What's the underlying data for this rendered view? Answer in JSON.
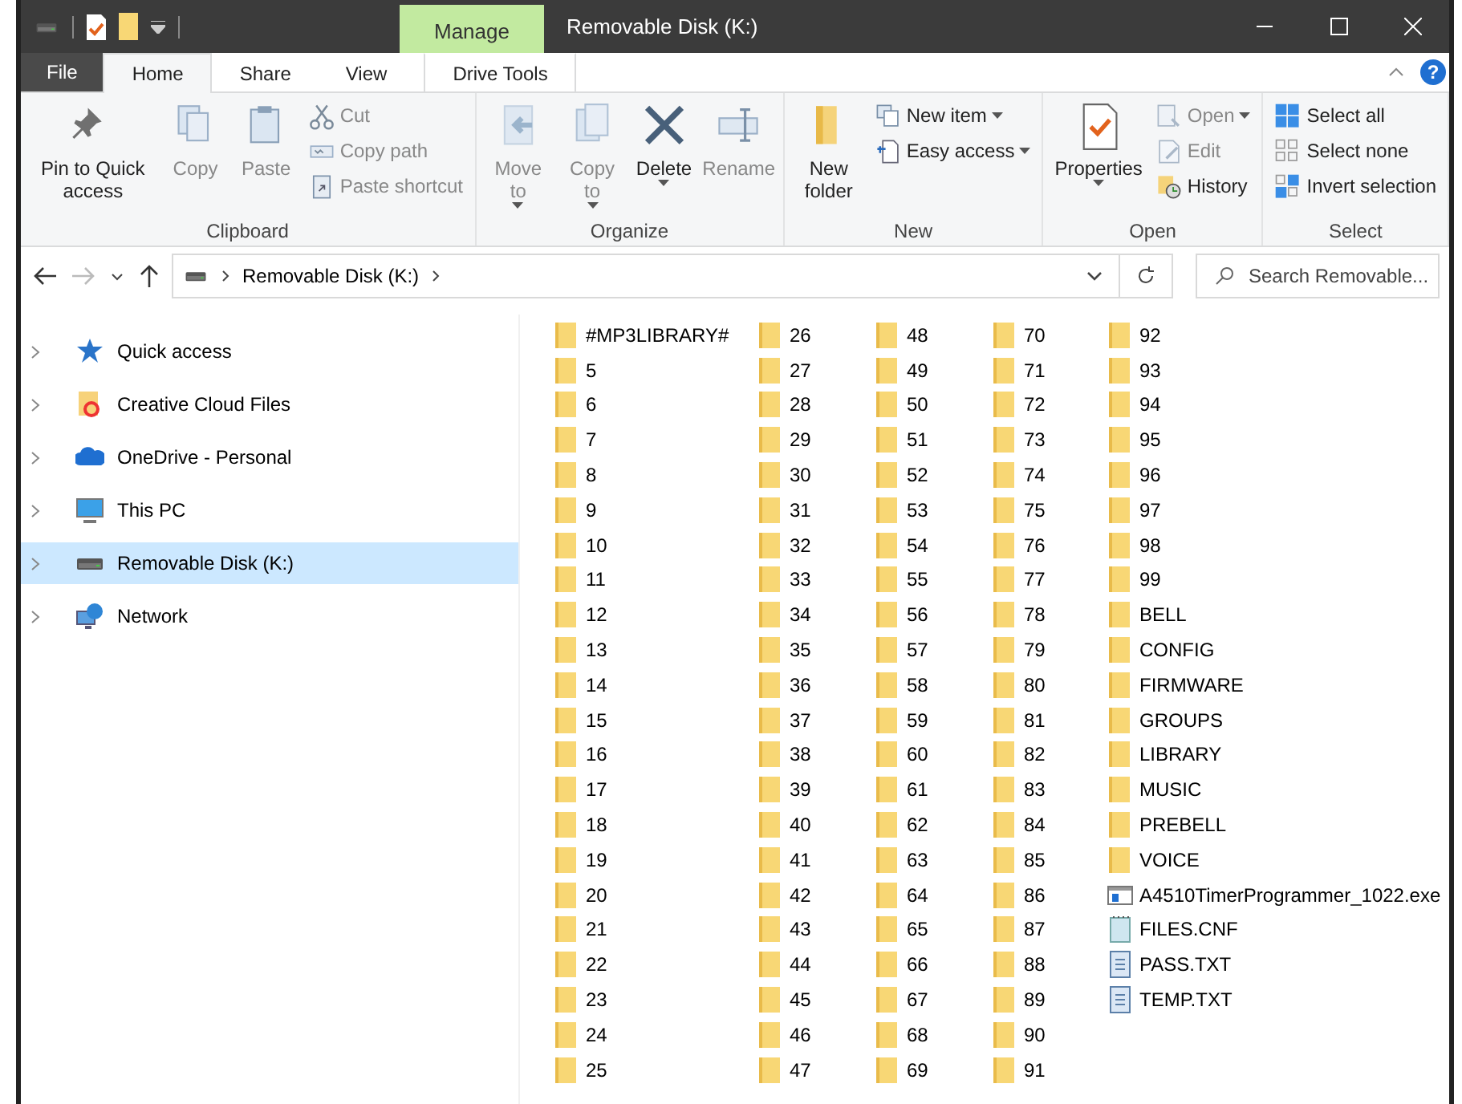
{
  "window": {
    "context_tab": "Manage",
    "title": "Removable Disk (K:)"
  },
  "ribbon_tabs": [
    {
      "label": "File",
      "kind": "file",
      "selected": false
    },
    {
      "label": "Home",
      "kind": "tab",
      "selected": true
    },
    {
      "label": "Share",
      "kind": "tab",
      "selected": false
    },
    {
      "label": "View",
      "kind": "tab",
      "selected": false
    },
    {
      "label": "Drive Tools",
      "kind": "context",
      "selected": false
    }
  ],
  "help": "?",
  "ribbon_groups": [
    {
      "name": "Clipboard",
      "items": [
        {
          "label": "Pin to Quick access",
          "kind": "large",
          "disabled": false,
          "dropdown": false
        },
        {
          "label": "Copy",
          "kind": "large",
          "disabled": true,
          "dropdown": false
        },
        {
          "label": "Paste",
          "kind": "large",
          "disabled": true,
          "dropdown": false
        },
        {
          "kind": "stack",
          "items": [
            {
              "label": "Cut",
              "disabled": true,
              "dropdown": false
            },
            {
              "label": "Copy path",
              "disabled": true,
              "dropdown": false
            },
            {
              "label": "Paste shortcut",
              "disabled": true,
              "dropdown": false
            }
          ]
        }
      ]
    },
    {
      "name": "Organize",
      "items": [
        {
          "label": "Move to",
          "kind": "large",
          "disabled": true,
          "dropdown": true
        },
        {
          "label": "Copy to",
          "kind": "large",
          "disabled": true,
          "dropdown": true
        },
        {
          "label": "Delete",
          "kind": "large",
          "disabled": false,
          "dropdown": true
        },
        {
          "label": "Rename",
          "kind": "large",
          "disabled": true,
          "dropdown": false
        }
      ]
    },
    {
      "name": "New",
      "items": [
        {
          "label": "New folder",
          "kind": "large",
          "disabled": false,
          "dropdown": false
        },
        {
          "kind": "stack",
          "items": [
            {
              "label": "New item",
              "disabled": false,
              "dropdown": true
            },
            {
              "label": "Easy access",
              "disabled": false,
              "dropdown": true
            }
          ]
        }
      ]
    },
    {
      "name": "Open",
      "items": [
        {
          "label": "Properties",
          "kind": "large",
          "disabled": false,
          "dropdown": true
        },
        {
          "kind": "stack",
          "items": [
            {
              "label": "Open",
              "disabled": true,
              "dropdown": true
            },
            {
              "label": "Edit",
              "disabled": true,
              "dropdown": false
            },
            {
              "label": "History",
              "disabled": false,
              "dropdown": false
            }
          ]
        }
      ]
    },
    {
      "name": "Select",
      "items": [
        {
          "kind": "stack",
          "items": [
            {
              "label": "Select all",
              "disabled": false,
              "dropdown": false
            },
            {
              "label": "Select none",
              "disabled": false,
              "dropdown": false
            },
            {
              "label": "Invert selection",
              "disabled": false,
              "dropdown": false
            }
          ]
        }
      ]
    }
  ],
  "address_bar": {
    "path": [
      "Removable Disk (K:)"
    ],
    "back_disabled": false,
    "forward_disabled": true
  },
  "search": {
    "placeholder": "Search Removable..."
  },
  "sidebar": {
    "items": [
      {
        "label": "Quick access",
        "kind": "star",
        "selected": false
      },
      {
        "label": "Creative Cloud Files",
        "kind": "cc",
        "selected": false
      },
      {
        "label": "OneDrive - Personal",
        "kind": "cloud",
        "selected": false
      },
      {
        "label": "This PC",
        "kind": "pc",
        "selected": false
      },
      {
        "label": "Removable Disk (K:)",
        "kind": "drive",
        "selected": true
      },
      {
        "label": "Network",
        "kind": "network",
        "selected": false
      }
    ]
  },
  "files": [
    {
      "name": "#MP3LIBRARY#",
      "kind": "folder"
    },
    {
      "name": "5",
      "kind": "folder"
    },
    {
      "name": "6",
      "kind": "folder"
    },
    {
      "name": "7",
      "kind": "folder"
    },
    {
      "name": "8",
      "kind": "folder"
    },
    {
      "name": "9",
      "kind": "folder"
    },
    {
      "name": "10",
      "kind": "folder"
    },
    {
      "name": "11",
      "kind": "folder"
    },
    {
      "name": "12",
      "kind": "folder"
    },
    {
      "name": "13",
      "kind": "folder"
    },
    {
      "name": "14",
      "kind": "folder"
    },
    {
      "name": "15",
      "kind": "folder"
    },
    {
      "name": "16",
      "kind": "folder"
    },
    {
      "name": "17",
      "kind": "folder"
    },
    {
      "name": "18",
      "kind": "folder"
    },
    {
      "name": "19",
      "kind": "folder"
    },
    {
      "name": "20",
      "kind": "folder"
    },
    {
      "name": "21",
      "kind": "folder"
    },
    {
      "name": "22",
      "kind": "folder"
    },
    {
      "name": "23",
      "kind": "folder"
    },
    {
      "name": "24",
      "kind": "folder"
    },
    {
      "name": "25",
      "kind": "folder"
    },
    {
      "name": "26",
      "kind": "folder"
    },
    {
      "name": "27",
      "kind": "folder"
    },
    {
      "name": "28",
      "kind": "folder"
    },
    {
      "name": "29",
      "kind": "folder"
    },
    {
      "name": "30",
      "kind": "folder"
    },
    {
      "name": "31",
      "kind": "folder"
    },
    {
      "name": "32",
      "kind": "folder"
    },
    {
      "name": "33",
      "kind": "folder"
    },
    {
      "name": "34",
      "kind": "folder"
    },
    {
      "name": "35",
      "kind": "folder"
    },
    {
      "name": "36",
      "kind": "folder"
    },
    {
      "name": "37",
      "kind": "folder"
    },
    {
      "name": "38",
      "kind": "folder"
    },
    {
      "name": "39",
      "kind": "folder"
    },
    {
      "name": "40",
      "kind": "folder"
    },
    {
      "name": "41",
      "kind": "folder"
    },
    {
      "name": "42",
      "kind": "folder"
    },
    {
      "name": "43",
      "kind": "folder"
    },
    {
      "name": "44",
      "kind": "folder"
    },
    {
      "name": "45",
      "kind": "folder"
    },
    {
      "name": "46",
      "kind": "folder"
    },
    {
      "name": "47",
      "kind": "folder"
    },
    {
      "name": "48",
      "kind": "folder"
    },
    {
      "name": "49",
      "kind": "folder"
    },
    {
      "name": "50",
      "kind": "folder"
    },
    {
      "name": "51",
      "kind": "folder"
    },
    {
      "name": "52",
      "kind": "folder"
    },
    {
      "name": "53",
      "kind": "folder"
    },
    {
      "name": "54",
      "kind": "folder"
    },
    {
      "name": "55",
      "kind": "folder"
    },
    {
      "name": "56",
      "kind": "folder"
    },
    {
      "name": "57",
      "kind": "folder"
    },
    {
      "name": "58",
      "kind": "folder"
    },
    {
      "name": "59",
      "kind": "folder"
    },
    {
      "name": "60",
      "kind": "folder"
    },
    {
      "name": "61",
      "kind": "folder"
    },
    {
      "name": "62",
      "kind": "folder"
    },
    {
      "name": "63",
      "kind": "folder"
    },
    {
      "name": "64",
      "kind": "folder"
    },
    {
      "name": "65",
      "kind": "folder"
    },
    {
      "name": "66",
      "kind": "folder"
    },
    {
      "name": "67",
      "kind": "folder"
    },
    {
      "name": "68",
      "kind": "folder"
    },
    {
      "name": "69",
      "kind": "folder"
    },
    {
      "name": "70",
      "kind": "folder"
    },
    {
      "name": "71",
      "kind": "folder"
    },
    {
      "name": "72",
      "kind": "folder"
    },
    {
      "name": "73",
      "kind": "folder"
    },
    {
      "name": "74",
      "kind": "folder"
    },
    {
      "name": "75",
      "kind": "folder"
    },
    {
      "name": "76",
      "kind": "folder"
    },
    {
      "name": "77",
      "kind": "folder"
    },
    {
      "name": "78",
      "kind": "folder"
    },
    {
      "name": "79",
      "kind": "folder"
    },
    {
      "name": "80",
      "kind": "folder"
    },
    {
      "name": "81",
      "kind": "folder"
    },
    {
      "name": "82",
      "kind": "folder"
    },
    {
      "name": "83",
      "kind": "folder"
    },
    {
      "name": "84",
      "kind": "folder"
    },
    {
      "name": "85",
      "kind": "folder"
    },
    {
      "name": "86",
      "kind": "folder"
    },
    {
      "name": "87",
      "kind": "folder"
    },
    {
      "name": "88",
      "kind": "folder"
    },
    {
      "name": "89",
      "kind": "folder"
    },
    {
      "name": "90",
      "kind": "folder"
    },
    {
      "name": "91",
      "kind": "folder"
    },
    {
      "name": "92",
      "kind": "folder"
    },
    {
      "name": "93",
      "kind": "folder"
    },
    {
      "name": "94",
      "kind": "folder"
    },
    {
      "name": "95",
      "kind": "folder"
    },
    {
      "name": "96",
      "kind": "folder"
    },
    {
      "name": "97",
      "kind": "folder"
    },
    {
      "name": "98",
      "kind": "folder"
    },
    {
      "name": "99",
      "kind": "folder"
    },
    {
      "name": "BELL",
      "kind": "folder"
    },
    {
      "name": "CONFIG",
      "kind": "folder"
    },
    {
      "name": "FIRMWARE",
      "kind": "folder"
    },
    {
      "name": "GROUPS",
      "kind": "folder"
    },
    {
      "name": "LIBRARY",
      "kind": "folder"
    },
    {
      "name": "MUSIC",
      "kind": "folder"
    },
    {
      "name": "PREBELL",
      "kind": "folder"
    },
    {
      "name": "VOICE",
      "kind": "folder"
    },
    {
      "name": "A4510TimerProgrammer_1022.exe",
      "kind": "exe"
    },
    {
      "name": "FILES.CNF",
      "kind": "config"
    },
    {
      "name": "PASS.TXT",
      "kind": "text"
    },
    {
      "name": "TEMP.TXT",
      "kind": "text"
    }
  ]
}
